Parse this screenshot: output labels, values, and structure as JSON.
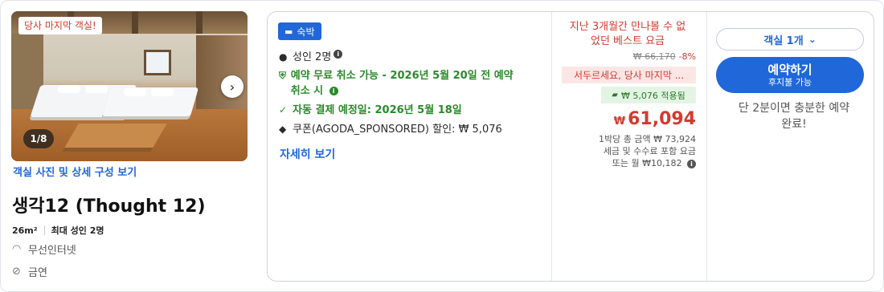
{
  "room": {
    "last_room_badge": "당사 마지막 객실!",
    "photo_counter": "1/8",
    "photos_link": "객실 사진 및 상세 구성 보기",
    "title": "생각12 (Thought 12)",
    "size": "26m²",
    "max_guests": "최대 성인 2명",
    "amenities": [
      {
        "icon": "wifi-icon",
        "label": "무선인터넷"
      },
      {
        "icon": "no-smoking-icon",
        "label": "금연"
      }
    ]
  },
  "offer": {
    "stay_badge": "숙박",
    "guests": "성인 2명",
    "free_cancel": "예약 무료 취소 가능 - 2026년 5월 20일 전 예약 취소 시",
    "auto_payment": "자동 결제 예정일: 2026년 5월 18일",
    "coupon": "쿠폰(AGODA_SPONSORED) 할인: ₩ 5,076",
    "details_link": "자세히 보기"
  },
  "pricing": {
    "promo_line1": "지난 3개월간 만나볼 수 없",
    "promo_line2": "었던 베스트 요금",
    "old_price": "₩ 66,170",
    "discount": "-8%",
    "hurry": "서두르세요, 당사 마지막 ...",
    "coupon_applied": "₩ 5,076 적용됨",
    "currency": "₩",
    "price": "61,094",
    "per_night_total": "1박당 총 금액 ₩ 73,924",
    "tax_note": "세금 및 수수료 포함 요금",
    "monthly": "또는 월 ₩10,182"
  },
  "booking": {
    "rooms_select": "객실 1개",
    "book_label": "예약하기",
    "book_sub": "후지불 가능",
    "urgency_line1": "단 2분이면 충분한 예약",
    "urgency_line2": "완료!"
  },
  "colors": {
    "accent": "#2067da",
    "price_red": "#d23b2f",
    "green": "#2a8a2a"
  }
}
